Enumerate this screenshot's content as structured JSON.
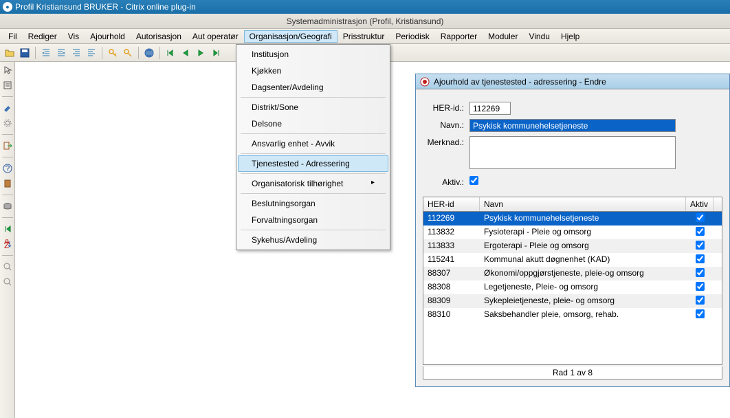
{
  "titlebar": {
    "title": "Profil Kristiansund BRUKER - Citrix online plug-in"
  },
  "subtitle": "Systemadministrasjon (Profil, Kristiansund)",
  "menubar": {
    "items": [
      "Fil",
      "Rediger",
      "Vis",
      "Ajourhold",
      "Autorisasjon",
      "Aut operatør",
      "Organisasjon/Geografi",
      "Prisstruktur",
      "Periodisk",
      "Rapporter",
      "Moduler",
      "Vindu",
      "Hjelp"
    ]
  },
  "dropdown": {
    "items": [
      {
        "label": "Institusjon",
        "type": "item"
      },
      {
        "label": "Kjøkken",
        "type": "item"
      },
      {
        "label": "Dagsenter/Avdeling",
        "type": "item"
      },
      {
        "type": "sep"
      },
      {
        "label": "Distrikt/Sone",
        "type": "item"
      },
      {
        "label": "Delsone",
        "type": "item"
      },
      {
        "type": "sep"
      },
      {
        "label": "Ansvarlig enhet - Avvik",
        "type": "item"
      },
      {
        "type": "sep"
      },
      {
        "label": "Tjenestested - Adressering",
        "type": "item",
        "highlighted": true
      },
      {
        "type": "sep"
      },
      {
        "label": "Organisatorisk tilhørighet",
        "type": "item",
        "hasSub": true
      },
      {
        "type": "sep"
      },
      {
        "label": "Beslutningsorgan",
        "type": "item"
      },
      {
        "label": "Forvaltningsorgan",
        "type": "item"
      },
      {
        "type": "sep"
      },
      {
        "label": "Sykehus/Avdeling",
        "type": "item"
      }
    ]
  },
  "sub_window": {
    "title": "Ajourhold av tjenestested - adressering - Endre",
    "form": {
      "her_id_label": "HER-id.:",
      "her_id_value": "112269",
      "navn_label": "Navn.:",
      "navn_value": "Psykisk kommunehelsetjeneste",
      "merknad_label": "Merknad.:",
      "merknad_value": "",
      "aktiv_label": "Aktiv.:",
      "aktiv_checked": true
    },
    "grid": {
      "headers": [
        "HER-id",
        "Navn",
        "Aktiv"
      ],
      "rows": [
        {
          "her_id": "112269",
          "navn": "Psykisk kommunehelsetjeneste",
          "aktiv": true,
          "selected": true
        },
        {
          "her_id": "113832",
          "navn": "Fysioterapi - Pleie og omsorg",
          "aktiv": true
        },
        {
          "her_id": "113833",
          "navn": "Ergoterapi - Pleie og omsorg",
          "aktiv": true
        },
        {
          "her_id": "115241",
          "navn": "Kommunal akutt døgnenhet (KAD)",
          "aktiv": true
        },
        {
          "her_id": "88307",
          "navn": "Økonomi/oppgjørstjeneste, pleie-og omsorg",
          "aktiv": true
        },
        {
          "her_id": "88308",
          "navn": "Legetjeneste, Pleie- og omsorg",
          "aktiv": true
        },
        {
          "her_id": "88309",
          "navn": "Sykepleietjeneste, pleie- og omsorg",
          "aktiv": true
        },
        {
          "her_id": "88310",
          "navn": "Saksbehandler pleie, omsorg, rehab.",
          "aktiv": true
        }
      ],
      "footer": "Rad 1 av 8"
    }
  }
}
